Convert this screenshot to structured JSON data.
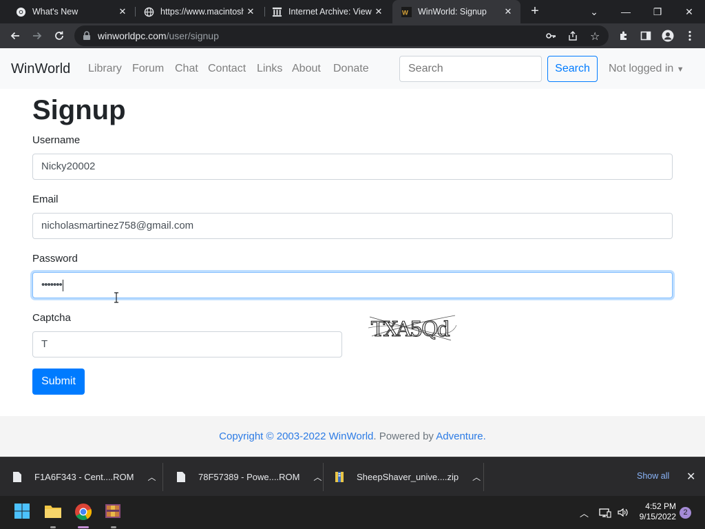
{
  "browser": {
    "tabs": [
      {
        "title": "What's New",
        "icon": "chrome-icon"
      },
      {
        "title": "https://www.macintosh",
        "icon": "globe-icon"
      },
      {
        "title": "Internet Archive: View /",
        "icon": "archive-icon"
      },
      {
        "title": "WinWorld: Signup",
        "icon": "winworld-icon",
        "active": true
      }
    ],
    "url_domain": "winworldpc.com",
    "url_path": "/user/signup"
  },
  "site": {
    "brand": "WinWorld",
    "nav": [
      "Library",
      "Forum",
      "Chat",
      "Contact",
      "Links",
      "About",
      "Donate"
    ],
    "search_placeholder": "Search",
    "search_button": "Search",
    "user_menu": "Not logged in"
  },
  "form": {
    "title": "Signup",
    "username_label": "Username",
    "username_value": "Nicky20002",
    "email_label": "Email",
    "email_value": "nicholasmartinez758@gmail.com",
    "password_label": "Password",
    "password_value": "•••••••",
    "captcha_label": "Captcha",
    "captcha_value": "T",
    "captcha_image_text": "TXA5Qd",
    "submit_label": "Submit"
  },
  "footer": {
    "copyright": "Copyright © 2003-2022 WinWorld",
    "powered_by_prefix": ". Powered by ",
    "powered_by": "Adventure",
    "end": "."
  },
  "downloads": {
    "items": [
      "F1A6F343 - Cent....ROM",
      "78F57389 - Powe....ROM",
      "SheepShaver_unive....zip"
    ],
    "show_all": "Show all"
  },
  "taskbar": {
    "time": "4:52 PM",
    "date": "9/15/2022",
    "notifications": "2"
  },
  "colors": {
    "primary": "#007bff",
    "link": "#2c7be5",
    "nav_bg": "#f8f9fa",
    "chrome_dark": "#202124"
  }
}
